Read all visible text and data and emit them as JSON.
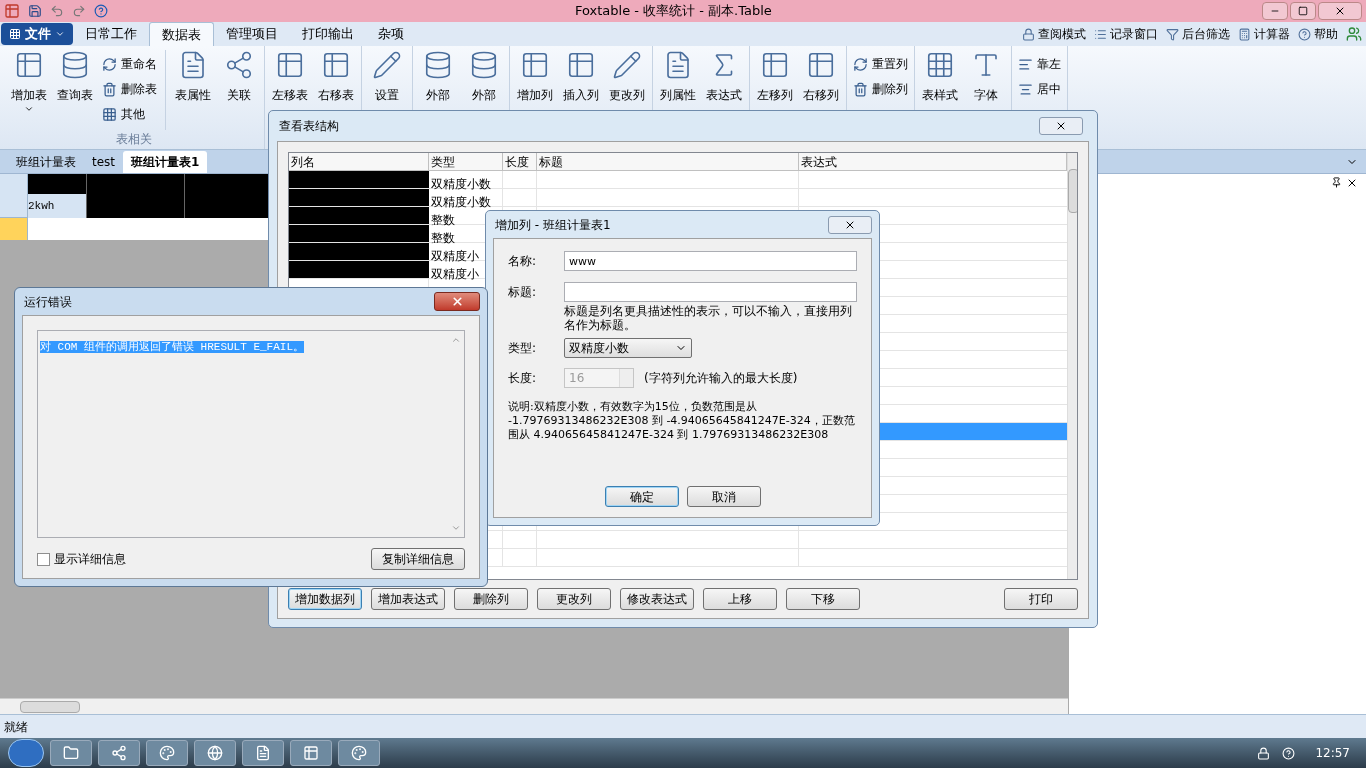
{
  "window": {
    "title": "Foxtable - 收率统计 - 副本.Table"
  },
  "menu_tabs": [
    {
      "label": "文件",
      "kind": "file",
      "selected": false
    },
    {
      "label": "日常工作",
      "kind": "tab",
      "selected": false
    },
    {
      "label": "数据表",
      "kind": "tab",
      "selected": true
    },
    {
      "label": "管理项目",
      "kind": "tab",
      "selected": false
    },
    {
      "label": "打印输出",
      "kind": "tab",
      "selected": false
    },
    {
      "label": "杂项",
      "kind": "tab",
      "selected": false
    }
  ],
  "quick_links": [
    "查阅模式",
    "记录窗口",
    "后台筛选",
    "计算器",
    "帮助"
  ],
  "ribbon": [
    {
      "label": "表相关",
      "items": [
        {
          "kind": "large",
          "label": "增加表",
          "dropdown": true
        },
        {
          "kind": "large",
          "label": "查询表"
        },
        {
          "kind": "stack",
          "labels": [
            "重命名",
            "删除表",
            "其他"
          ]
        },
        {
          "kind": "sep"
        },
        {
          "kind": "large",
          "label": "表属性"
        },
        {
          "kind": "large",
          "label": "关联"
        }
      ]
    },
    {
      "items": [
        {
          "kind": "large",
          "label": "左移表"
        },
        {
          "kind": "large",
          "label": "右移表"
        }
      ]
    },
    {
      "items": [
        {
          "kind": "large",
          "label": "设置"
        }
      ]
    },
    {
      "items": [
        {
          "kind": "large",
          "label": "外部"
        },
        {
          "kind": "large",
          "label": "外部"
        }
      ]
    },
    {
      "items": [
        {
          "kind": "large",
          "label": "增加列"
        },
        {
          "kind": "large",
          "label": "插入列"
        },
        {
          "kind": "large",
          "label": "更改列"
        }
      ]
    },
    {
      "items": [
        {
          "kind": "large",
          "label": "列属性"
        },
        {
          "kind": "large",
          "label": "表达式"
        }
      ]
    },
    {
      "items": [
        {
          "kind": "large",
          "label": "左移列"
        },
        {
          "kind": "large",
          "label": "右移列"
        }
      ]
    },
    {
      "items": [
        {
          "kind": "stack",
          "labels": [
            "重置列",
            "删除列"
          ]
        }
      ]
    },
    {
      "items": [
        {
          "kind": "large",
          "label": "表样式"
        },
        {
          "kind": "large",
          "label": "字体"
        }
      ]
    },
    {
      "items": [
        {
          "kind": "stack",
          "labels": [
            "靠左",
            "居中"
          ]
        }
      ]
    }
  ],
  "doc_tabs": [
    {
      "label": "班组计量表",
      "selected": false
    },
    {
      "label": "test",
      "selected": false
    },
    {
      "label": "班组计量表1",
      "selected": true
    }
  ],
  "grid": {
    "unit_cell": "2kwh"
  },
  "status_bar": "就绪",
  "structure_dialog": {
    "title": "查看表结构",
    "columns": [
      "列名",
      "类型",
      "长度",
      "标题",
      "表达式"
    ],
    "rows": [
      {
        "type": "双精度小数",
        "selected": false
      },
      {
        "type": "双精度小数",
        "selected": false
      },
      {
        "type": "整数",
        "selected": false
      },
      {
        "type": "整数",
        "selected": false
      },
      {
        "type": "双精度小",
        "selected": false
      },
      {
        "type": "双精度小",
        "selected": false
      },
      {
        "selected": false
      },
      {
        "selected": false
      },
      {
        "selected": false
      },
      {
        "selected": false
      },
      {
        "selected": false
      },
      {
        "selected": false
      },
      {
        "selected": false
      },
      {
        "selected": false
      },
      {
        "selected": true
      },
      {
        "selected": false
      },
      {
        "selected": false
      },
      {
        "selected": false
      },
      {
        "selected": false
      },
      {
        "selected": false
      },
      {
        "selected": false
      },
      {
        "selected": false
      }
    ],
    "buttons": [
      "增加数据列",
      "增加表达式",
      "删除列",
      "更改列",
      "修改表达式",
      "上移",
      "下移",
      "打印"
    ]
  },
  "add_column_dialog": {
    "title": "增加列 - 班组计量表1",
    "name_label": "名称:",
    "name_value": "www",
    "caption_label": "标题:",
    "caption_hint": "标题是列名更具描述性的表示，可以不输入，直接用列名作为标题。",
    "type_label": "类型:",
    "type_value": "双精度小数",
    "length_label": "长度:",
    "length_value": "16",
    "length_disabled": true,
    "length_hint": "(字符列允许输入的最大长度)",
    "description": "说明:双精度小数，有效数字为15位，负数范围是从 -1.79769313486232E308 到 -4.94065645841247E-324，正数范围从 4.94065645841247E-324 到 1.79769313486232E308",
    "buttons": [
      "确定",
      "取消"
    ]
  },
  "error_dialog": {
    "title": "运行错误",
    "message": "对 COM 组件的调用返回了错误 HRESULT E_FAIL。",
    "show_details": {
      "label": "显示详细信息",
      "checked": false
    },
    "button": "复制详细信息"
  },
  "taskbar": {
    "time": "12:57"
  }
}
